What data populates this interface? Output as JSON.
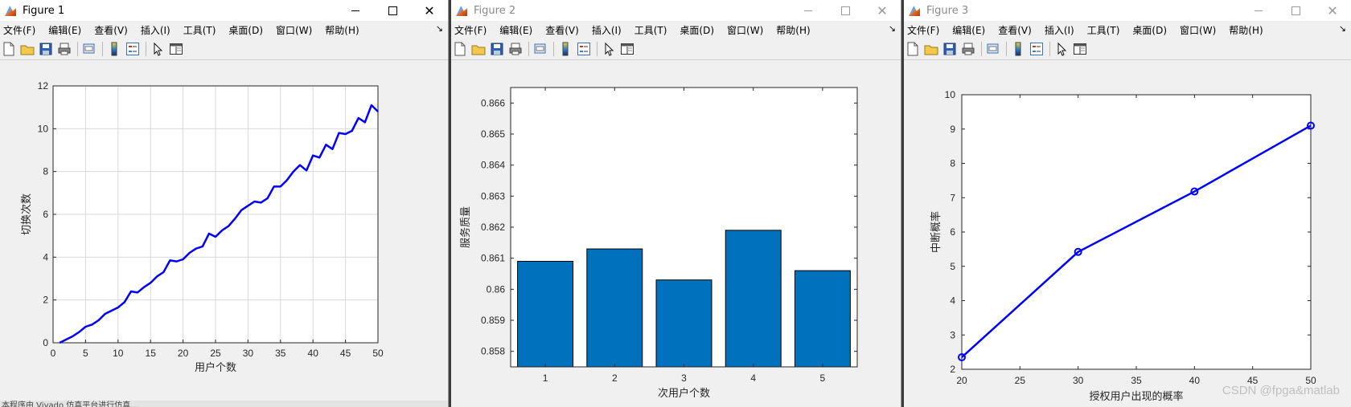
{
  "windows": [
    {
      "title": "Figure 1",
      "active": true,
      "menus": [
        "文件(F)",
        "编辑(E)",
        "查看(V)",
        "插入(I)",
        "工具(T)",
        "桌面(D)",
        "窗口(W)",
        "帮助(H)"
      ]
    },
    {
      "title": "Figure 2",
      "active": false,
      "menus": [
        "文件(F)",
        "编辑(E)",
        "查看(V)",
        "插入(I)",
        "工具(T)",
        "桌面(D)",
        "窗口(W)",
        "帮助(H)"
      ]
    },
    {
      "title": "Figure 3",
      "active": false,
      "menus": [
        "文件(F)",
        "编辑(E)",
        "查看(V)",
        "插入(I)",
        "工具(T)",
        "桌面(D)",
        "窗口(W)",
        "帮助(H)"
      ]
    }
  ],
  "toolbar_icons": [
    "new-file-icon",
    "open-folder-icon",
    "save-icon",
    "print-icon",
    "print-preview-icon",
    "colorbar-icon",
    "legend-icon",
    "pointer-icon",
    "property-editor-icon"
  ],
  "menu_overflow_glyph": "↘",
  "status_text": "本程序由 Vivado 仿真平台进行仿真...",
  "watermark": "CSDN @fpga&matlab",
  "colors": {
    "line": "#0000ff",
    "bar": "#0072bd",
    "grid": "#d9d9d9"
  },
  "chart_data": [
    {
      "type": "line",
      "title": "",
      "xlabel": "用户个数",
      "ylabel": "切换次数",
      "xlim": [
        0,
        50
      ],
      "ylim": [
        0,
        12
      ],
      "xticks": [
        0,
        5,
        10,
        15,
        20,
        25,
        30,
        35,
        40,
        45,
        50
      ],
      "yticks": [
        0,
        2,
        4,
        6,
        8,
        10,
        12
      ],
      "grid": true,
      "x": [
        1,
        2,
        3,
        4,
        5,
        6,
        7,
        8,
        9,
        10,
        11,
        12,
        13,
        14,
        15,
        16,
        17,
        18,
        19,
        20,
        21,
        22,
        23,
        24,
        25,
        26,
        27,
        28,
        29,
        30,
        31,
        32,
        33,
        34,
        35,
        36,
        37,
        38,
        39,
        40,
        41,
        42,
        43,
        44,
        45,
        46,
        47,
        48,
        49,
        50
      ],
      "series": [
        {
          "values": [
            0.0,
            0.15,
            0.3,
            0.5,
            0.75,
            0.85,
            1.05,
            1.35,
            1.5,
            1.65,
            1.9,
            2.4,
            2.35,
            2.6,
            2.8,
            3.1,
            3.3,
            3.85,
            3.8,
            3.9,
            4.2,
            4.4,
            4.5,
            5.1,
            4.95,
            5.25,
            5.45,
            5.8,
            6.2,
            6.4,
            6.6,
            6.55,
            6.75,
            7.3,
            7.3,
            7.6,
            8.0,
            8.3,
            8.05,
            8.75,
            8.65,
            9.25,
            9.05,
            9.8,
            9.75,
            9.9,
            10.5,
            10.3,
            11.1,
            10.8
          ]
        }
      ]
    },
    {
      "type": "bar",
      "title": "",
      "xlabel": "次用户个数",
      "ylabel": "服务质量",
      "categories": [
        "1",
        "2",
        "3",
        "4",
        "5"
      ],
      "ylim": [
        0.8575,
        0.8665
      ],
      "yticks": [
        0.858,
        0.859,
        0.86,
        0.861,
        0.862,
        0.863,
        0.864,
        0.865,
        0.866
      ],
      "ytick_labels": [
        "0.858",
        "0.859",
        "0.86",
        "0.861",
        "0.862",
        "0.863",
        "0.864",
        "0.865",
        "0.866"
      ],
      "grid": false,
      "values": [
        0.8609,
        0.8613,
        0.8603,
        0.8619,
        0.8606
      ]
    },
    {
      "type": "line",
      "title": "",
      "xlabel": "授权用户出现的概率",
      "ylabel": "中断概率",
      "xlim": [
        20,
        50
      ],
      "ylim": [
        2,
        10
      ],
      "xticks": [
        20,
        25,
        30,
        35,
        40,
        45,
        50
      ],
      "yticks": [
        2,
        3,
        4,
        5,
        6,
        7,
        8,
        9,
        10
      ],
      "grid": false,
      "markers": "circle",
      "x": [
        20,
        30,
        40,
        50
      ],
      "series": [
        {
          "values": [
            2.35,
            5.42,
            7.18,
            9.1
          ]
        }
      ]
    }
  ]
}
